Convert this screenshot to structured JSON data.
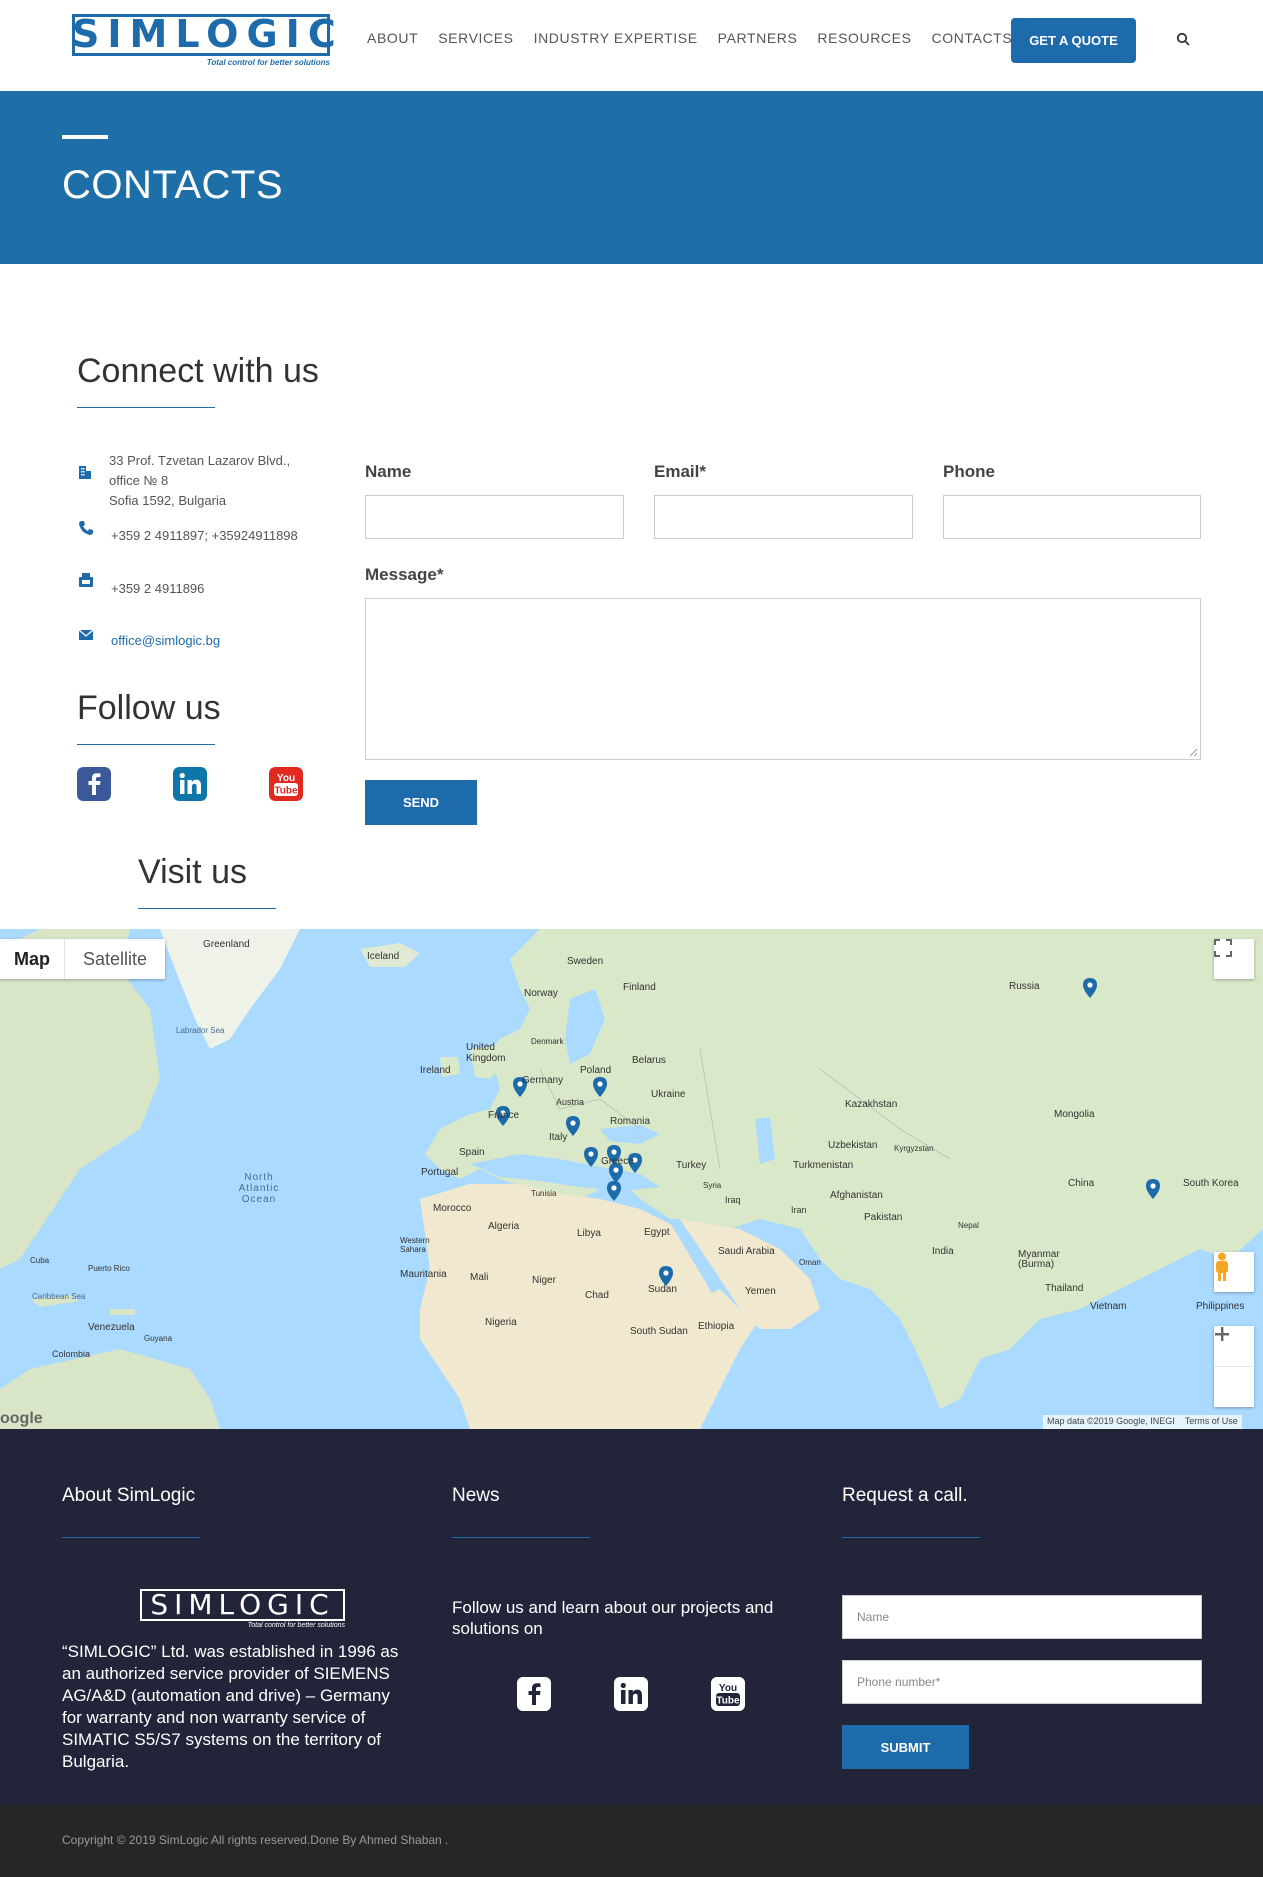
{
  "header": {
    "logo_text": "SIMLOGIC",
    "logo_tagline": "Total control for better solutions",
    "nav": [
      "ABOUT",
      "SERVICES",
      "INDUSTRY EXPERTISE",
      "PARTNERS",
      "RESOURCES",
      "CONTACTS"
    ],
    "quote_button": "GET A QUOTE"
  },
  "banner": {
    "title": "CONTACTS"
  },
  "connect": {
    "title": "Connect with us",
    "address_lines": [
      "33 Prof. Tzvetan Lazarov Blvd.,",
      "office № 8",
      "Sofia 1592, Bulgaria"
    ],
    "phone": "+359 2 4911897; +35924911898",
    "fax": "+359 2 4911896",
    "email": "office@simlogic.bg"
  },
  "follow": {
    "title": "Follow us"
  },
  "visit": {
    "title": "Visit us"
  },
  "form": {
    "name_label": "Name",
    "email_label": "Email*",
    "phone_label": "Phone",
    "message_label": "Message*",
    "send_label": "SEND"
  },
  "map": {
    "tab_map": "Map",
    "tab_satellite": "Satellite",
    "attribution": "Map data ©2019 Google, INEGI",
    "terms": "Terms of Use",
    "labels": [
      "Greenland",
      "Iceland",
      "Sweden",
      "Finland",
      "Norway",
      "Russia",
      "United Kingdom",
      "Denmark",
      "Ireland",
      "Poland",
      "Belarus",
      "Germany",
      "Ukraine",
      "France",
      "Austria",
      "Romania",
      "Kazakhstan",
      "Mongolia",
      "Italy",
      "Spain",
      "Portugal",
      "Greece",
      "Turkey",
      "Uzbekistan",
      "Kyrgyzstan",
      "Turkmenistan",
      "China",
      "South Korea",
      "North Atlantic Ocean",
      "Labrador Sea",
      "Tunisia",
      "Syria",
      "Iraq",
      "Iran",
      "Afghanistan",
      "Morocco",
      "Algeria",
      "Libya",
      "Egypt",
      "Pakistan",
      "Nepal",
      "Saudi Arabia",
      "India",
      "Western Sahara",
      "Oman",
      "Myanmar (Burma)",
      "Mauritania",
      "Mali",
      "Niger",
      "Chad",
      "Sudan",
      "Yemen",
      "Thailand",
      "Cuba",
      "Puerto Rico",
      "Caribbean Sea",
      "Venezuela",
      "Guyana",
      "Colombia",
      "Nigeria",
      "South Sudan",
      "Ethiopia",
      "Vietnam",
      "Philippines"
    ]
  },
  "footer": {
    "about_title": "About SimLogic",
    "news_title": "News",
    "call_title": "Request a call.",
    "about_text": "“SIMLOGIC” Ltd. was established in 1996 as an authorized service provider of SIEMENS AG/A&D (automation and drive) – Germany for warranty and non warranty service of SIMATIC S5/S7 systems on the territory of Bulgaria.",
    "news_text": "Follow us and learn about our projects and solutions on",
    "name_placeholder": "Name",
    "phone_placeholder": "Phone number*",
    "submit_label": "SUBMIT"
  },
  "copyright": "Copyright © 2019 SimLogic All rights reserved.Done By Ahmed Shaban ."
}
